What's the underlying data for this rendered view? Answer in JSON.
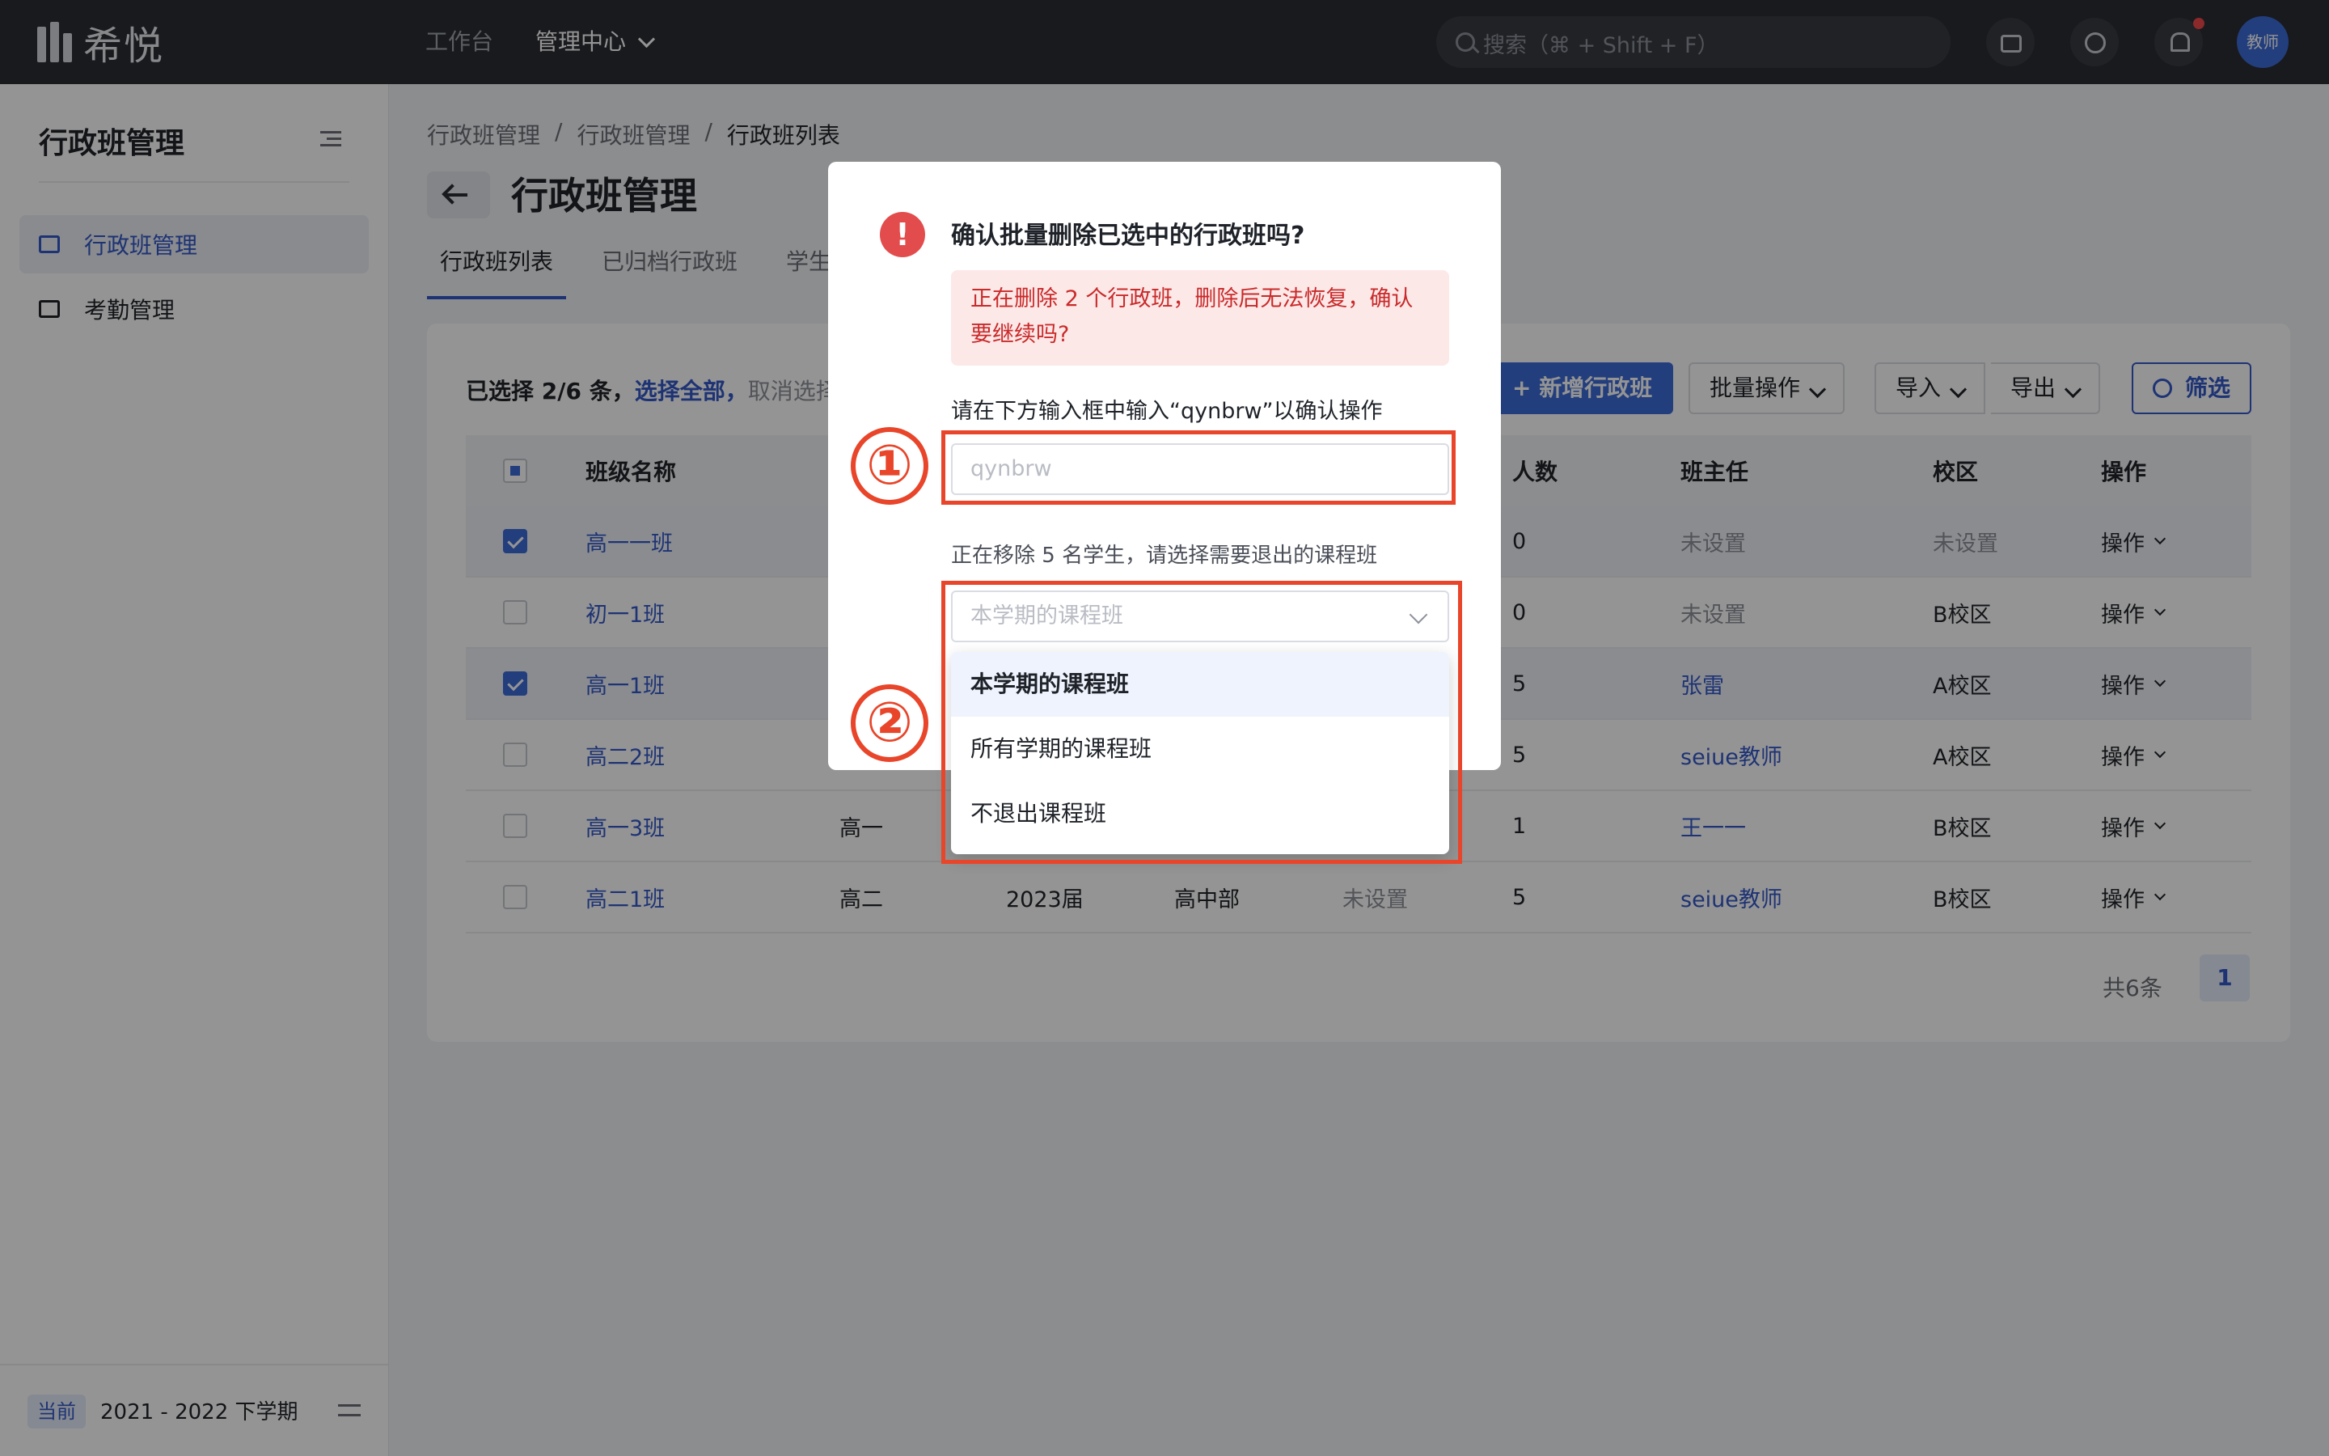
{
  "topbar": {
    "logo_text": "希悦",
    "nav": [
      {
        "label": "工作台"
      },
      {
        "label": "管理中心"
      }
    ],
    "search_placeholder": "搜索（⌘ + Shift + F）",
    "avatar_text": "教师",
    "notification_dot_color": "#f0474a"
  },
  "sidebar": {
    "title": "行政班管理",
    "items": [
      {
        "label": "行政班管理",
        "icon": "class-list-icon"
      },
      {
        "label": "考勤管理",
        "icon": "calendar-check-icon"
      }
    ],
    "footer": {
      "tag": "当前",
      "term": "2021 - 2022 下学期"
    }
  },
  "main": {
    "breadcrumb": [
      "行政班管理",
      "/",
      "行政班管理",
      "/",
      "行政班列表"
    ],
    "title": "行政班管理",
    "tabs": [
      {
        "label": "行政班列表"
      },
      {
        "label": "已归档行政班"
      },
      {
        "label": "学生"
      }
    ],
    "selection": {
      "prefix": "已选择 2/6 条，",
      "select_all": "选择全部，",
      "cancel": "取消选择"
    },
    "buttons": {
      "add": "+ 新增行政班",
      "batch": "批量操作",
      "import": "导入",
      "export": "导出",
      "filter": "筛选"
    },
    "table": {
      "headers": [
        "班级名称",
        "人数",
        "班主任",
        "校区",
        "操作"
      ],
      "rows": [
        {
          "name": "高一一班",
          "grade": "",
          "year": "",
          "dept": "",
          "subject": "",
          "count": "0",
          "teacher": "未设置",
          "campus": "未设置",
          "op": "操作",
          "checked": true
        },
        {
          "name": "初一1班",
          "grade": "",
          "year": "",
          "dept": "",
          "subject": "",
          "count": "0",
          "teacher": "未设置",
          "campus": "B校区",
          "op": "操作",
          "checked": false
        },
        {
          "name": "高一1班",
          "grade": "",
          "year": "",
          "dept": "",
          "subject": "",
          "count": "5",
          "teacher": "张雷",
          "campus": "A校区",
          "op": "操作",
          "checked": true
        },
        {
          "name": "高二2班",
          "grade": "",
          "year": "",
          "dept": "",
          "subject": "",
          "count": "5",
          "teacher": "seiue教师",
          "campus": "A校区",
          "op": "操作",
          "checked": false
        },
        {
          "name": "高一3班",
          "grade": "高一",
          "year": "",
          "dept": "",
          "subject": "",
          "count": "1",
          "teacher": "王一一",
          "campus": "B校区",
          "op": "操作",
          "checked": false
        },
        {
          "name": "高二1班",
          "grade": "高二",
          "year": "2023届",
          "dept": "高中部",
          "subject": "未设置",
          "count": "5",
          "teacher": "seiue教师",
          "campus": "B校区",
          "op": "操作",
          "checked": false
        }
      ]
    },
    "pager": {
      "total": "共6条",
      "page": "1"
    }
  },
  "modal": {
    "icon": "!",
    "title": "确认批量删除已选中的行政班吗?",
    "alert": "正在删除 2 个行政班，删除后无法恢复，确认要继续吗?",
    "hint": "请在下方输入框中输入“qynbrw”以确认操作",
    "input_placeholder": "qynbrw",
    "info": "正在移除 5 名学生，请选择需要退出的课程班",
    "select_placeholder": "本学期的课程班",
    "options": [
      "本学期的课程班",
      "所有学期的课程班",
      "不退出课程班"
    ]
  },
  "annotations": {
    "one": "①",
    "two": "②",
    "color": "#e8452a"
  }
}
